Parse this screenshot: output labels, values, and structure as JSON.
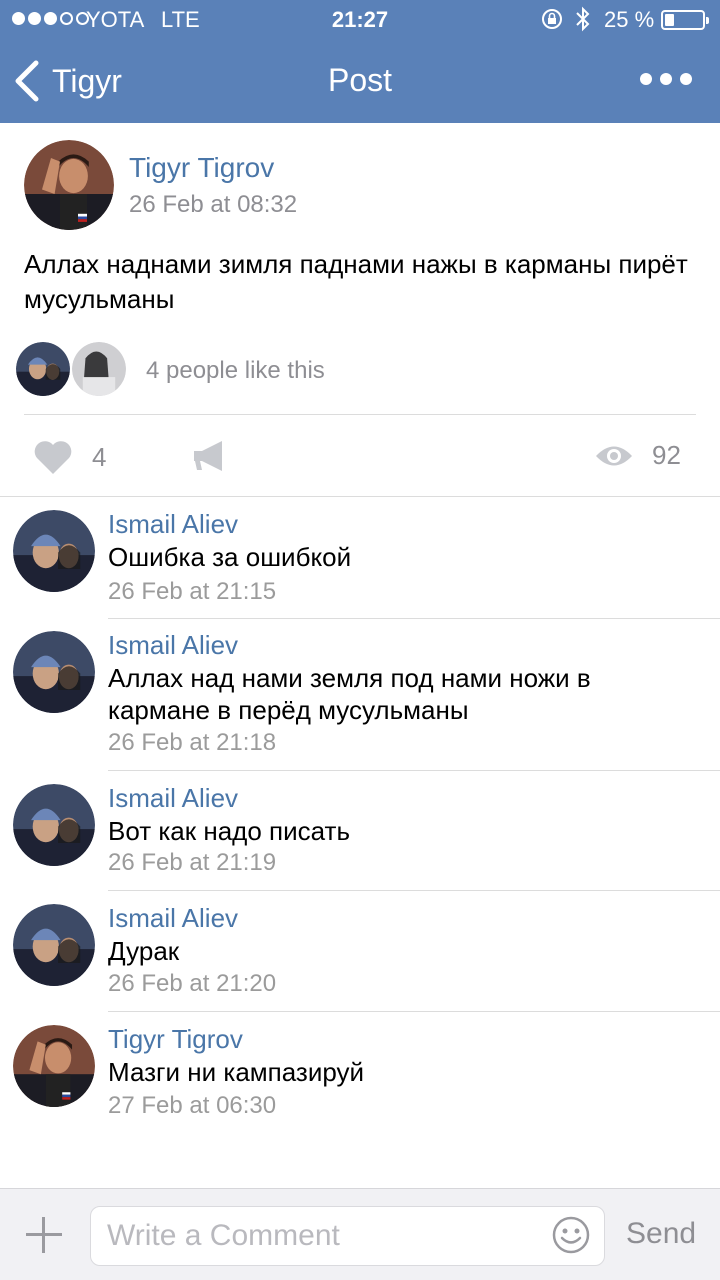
{
  "status_bar": {
    "carrier": "YOTA",
    "network": "LTE",
    "time": "21:27",
    "battery": "25 %",
    "battery_level": 0.25,
    "signal_strength": 3,
    "icons": [
      "orientation-lock-icon",
      "bluetooth-icon",
      "battery-icon"
    ]
  },
  "nav": {
    "back_label": "Tigyr",
    "title": "Post",
    "more_icon": "more-icon"
  },
  "post": {
    "author": "Tigyr Tigrov",
    "date": "26 Feb at 08:32",
    "text": "Аллах наднами зимля паднами нажы в карманы пирёт мусульманы",
    "likers_text": "4 people like this",
    "like_count": "4",
    "views_count": "92"
  },
  "comments": [
    {
      "author": "Ismail Aliev",
      "text": "Ошибка за ошибкой",
      "date": "26 Feb at 21:15"
    },
    {
      "author": "Ismail Aliev",
      "text": "Аллах над нами земля под нами ножи в кармане в перёд мусульманы",
      "date": "26 Feb at 21:18"
    },
    {
      "author": "Ismail Aliev",
      "text": "Вот как надо писать",
      "date": "26 Feb at 21:19"
    },
    {
      "author": "Ismail Aliev",
      "text": "Дурак",
      "date": "26 Feb at 21:20"
    },
    {
      "author": "Tigyr Tigrov",
      "text": "Мазги ни кампазируй",
      "date": "27 Feb at 06:30"
    }
  ],
  "composer": {
    "placeholder": "Write a Comment",
    "send_label": "Send"
  },
  "colors": {
    "header": "#5a81b8",
    "link": "#4a76a8",
    "meta": "#8e8e93"
  }
}
